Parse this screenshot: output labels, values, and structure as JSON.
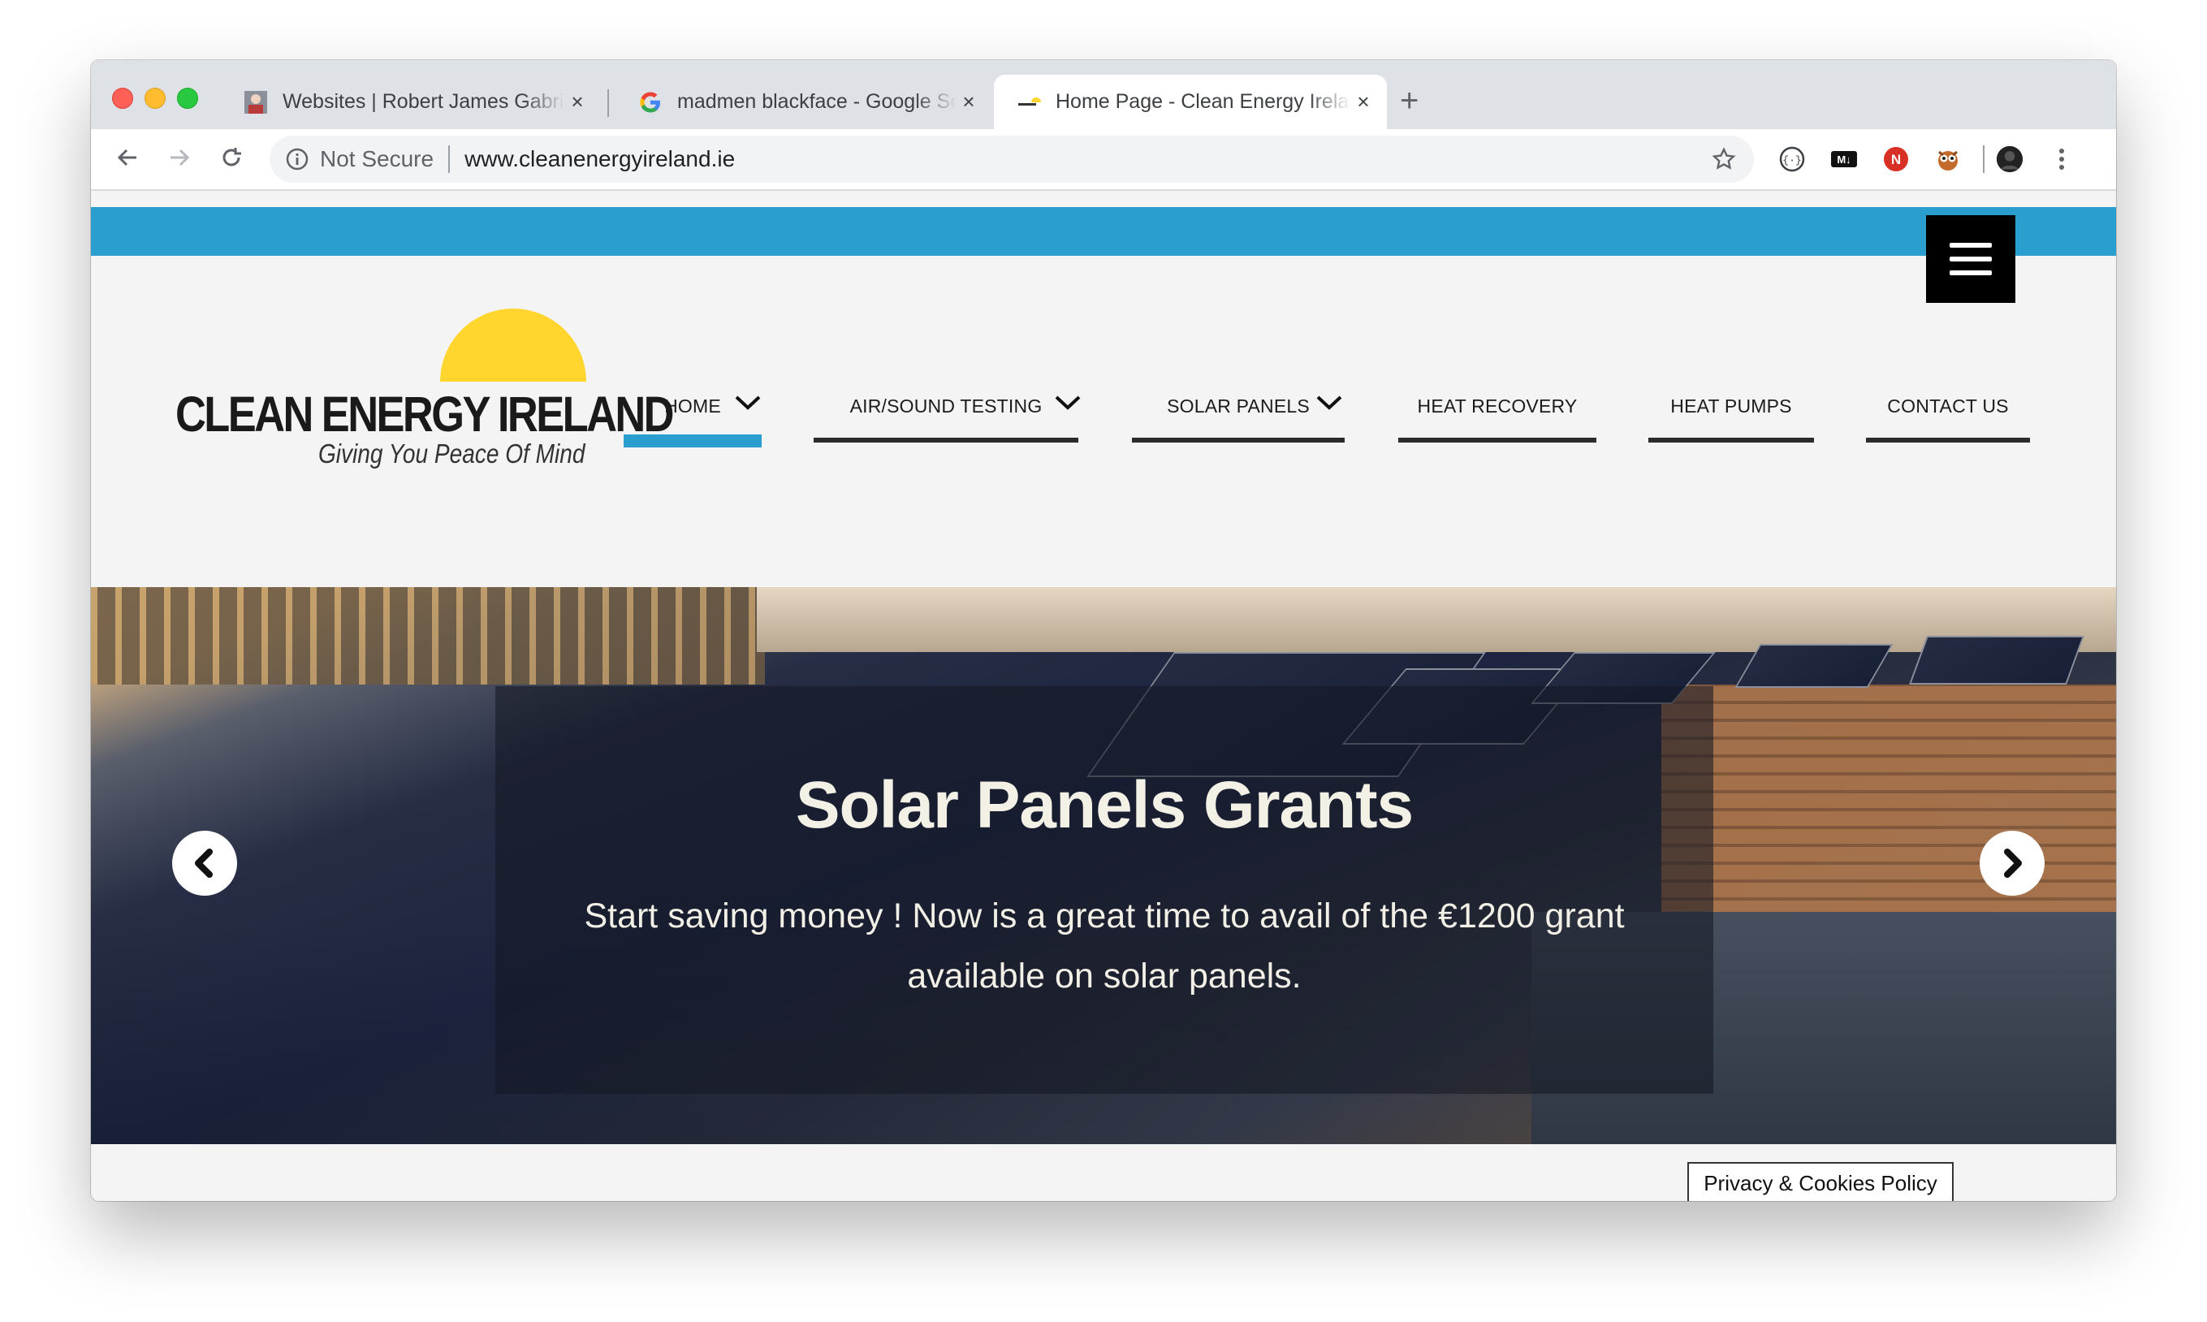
{
  "browser": {
    "tabs": [
      {
        "title": "Websites | Robert James Gabriel",
        "favicon": "avatar-favicon",
        "close": "×"
      },
      {
        "title": "madmen blackface - Google Search",
        "favicon": "google-g-favicon",
        "close": "×"
      },
      {
        "title": "Home Page - Clean Energy Ireland",
        "favicon": "clean-energy-favicon",
        "close": "×",
        "active": true
      }
    ],
    "new_tab": "+",
    "security_label": "Not Secure",
    "url": "www.cleanenergyireland.ie",
    "colors": {
      "tab_strip": "#dee1e6",
      "toolbar": "#ffffff"
    }
  },
  "site": {
    "logo": {
      "name": "CLEAN ENERGY IRELAND",
      "tagline": "Giving You Peace Of Mind"
    },
    "menu": [
      {
        "label": "HOME",
        "active": true,
        "has_dropdown": true
      },
      {
        "label": "AIR/SOUND TESTING",
        "active": false,
        "has_dropdown": true
      },
      {
        "label": "SOLAR PANELS",
        "active": false,
        "has_dropdown": true
      },
      {
        "label": "HEAT RECOVERY",
        "active": false,
        "has_dropdown": false
      },
      {
        "label": "HEAT PUMPS",
        "active": false,
        "has_dropdown": false
      },
      {
        "label": "CONTACT US",
        "active": false,
        "has_dropdown": false
      }
    ],
    "hero": {
      "title": "Solar Panels Grants",
      "text": "Start saving money ! Now is a great time to avail of the €1200 grant available on solar panels."
    },
    "privacy_link": "Privacy & Cookies Policy",
    "colors": {
      "accent": "#2a9fcf",
      "sun": "#ffd52e",
      "menu_bar": "#2b2b2b"
    }
  }
}
